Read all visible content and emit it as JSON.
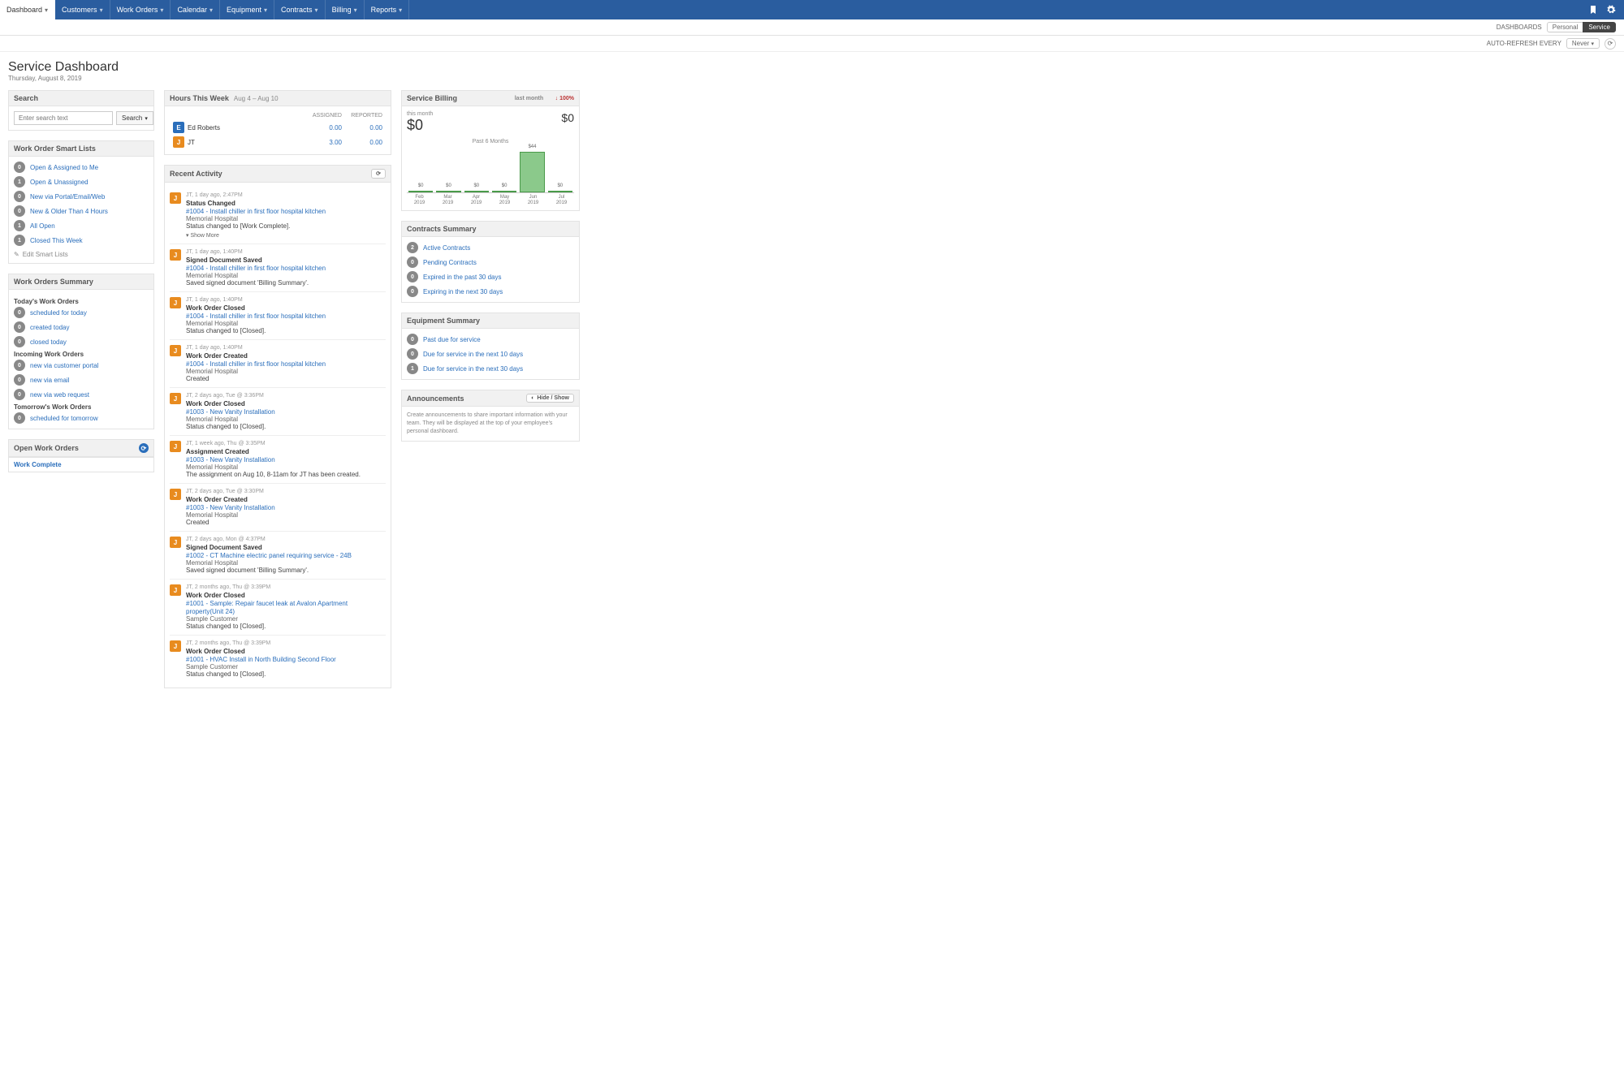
{
  "nav": {
    "tabs": [
      "Dashboard",
      "Customers",
      "Work Orders",
      "Calendar",
      "Equipment",
      "Contracts",
      "Billing",
      "Reports"
    ],
    "active": 0
  },
  "subbar": {
    "dashboards_label": "DASHBOARDS",
    "personal": "Personal",
    "service": "Service",
    "auto_refresh_label": "AUTO-REFRESH EVERY",
    "auto_refresh_value": "Never"
  },
  "header": {
    "title": "Service Dashboard",
    "date": "Thursday, August 8, 2019"
  },
  "search": {
    "title": "Search",
    "placeholder": "Enter search text",
    "button": "Search"
  },
  "smart_lists": {
    "title": "Work Order Smart Lists",
    "items": [
      {
        "count": "0",
        "label": "Open & Assigned to Me"
      },
      {
        "count": "1",
        "label": "Open & Unassigned"
      },
      {
        "count": "0",
        "label": "New via Portal/Email/Web"
      },
      {
        "count": "0",
        "label": "New & Older Than 4 Hours"
      },
      {
        "count": "1",
        "label": "All Open"
      },
      {
        "count": "1",
        "label": "Closed This Week"
      }
    ],
    "edit": "Edit Smart Lists"
  },
  "wo_summary": {
    "title": "Work Orders Summary",
    "groups": [
      {
        "label": "Today's Work Orders",
        "items": [
          {
            "count": "0",
            "label": "scheduled for today"
          },
          {
            "count": "0",
            "label": "created today"
          },
          {
            "count": "0",
            "label": "closed today"
          }
        ]
      },
      {
        "label": "Incoming Work Orders",
        "items": [
          {
            "count": "0",
            "label": "new via customer portal"
          },
          {
            "count": "0",
            "label": "new via email"
          },
          {
            "count": "0",
            "label": "new via web request"
          }
        ]
      },
      {
        "label": "Tomorrow's Work Orders",
        "items": [
          {
            "count": "0",
            "label": "scheduled for tomorrow"
          }
        ]
      }
    ]
  },
  "open_wo": {
    "title": "Open Work Orders",
    "bar": "Work Complete"
  },
  "hours": {
    "title": "Hours This Week",
    "range": "Aug 4 – Aug 10",
    "cols": [
      "ASSIGNED",
      "REPORTED"
    ],
    "rows": [
      {
        "avatar": "E",
        "color": "blue",
        "name": "Ed Roberts",
        "assigned": "0.00",
        "reported": "0.00"
      },
      {
        "avatar": "J",
        "color": "orange",
        "name": "JT",
        "assigned": "3.00",
        "reported": "0.00"
      }
    ]
  },
  "activity": {
    "title": "Recent Activity",
    "reload": "",
    "items": [
      {
        "avatar": "J",
        "meta": "JT, 1 day ago, 2:47PM",
        "title": "Status Changed",
        "link": "#1004 - Install chiller in first floor hospital kitchen",
        "sub": "Memorial Hospital",
        "body": "Status changed to [Work Complete].",
        "more": true
      },
      {
        "avatar": "J",
        "meta": "JT, 1 day ago, 1:40PM",
        "title": "Signed Document Saved",
        "link": "#1004 - Install chiller in first floor hospital kitchen",
        "sub": "Memorial Hospital",
        "body": "Saved signed document 'Billing Summary'."
      },
      {
        "avatar": "J",
        "meta": "JT, 1 day ago, 1:40PM",
        "title": "Work Order Closed",
        "link": "#1004 - Install chiller in first floor hospital kitchen",
        "sub": "Memorial Hospital",
        "body": "Status changed to [Closed]."
      },
      {
        "avatar": "J",
        "meta": "JT, 1 day ago, 1:40PM",
        "title": "Work Order Created",
        "link": "#1004 - Install chiller in first floor hospital kitchen",
        "sub": "Memorial Hospital",
        "body": "Created"
      },
      {
        "avatar": "J",
        "meta": "JT, 2 days ago, Tue @ 3:36PM",
        "title": "Work Order Closed",
        "link": "#1003 - New Vanity Installation",
        "sub": "Memorial Hospital",
        "body": "Status changed to [Closed]."
      },
      {
        "avatar": "J",
        "meta": "JT, 1 week ago, Thu @ 3:35PM",
        "title": "Assignment Created",
        "link": "#1003 - New Vanity Installation",
        "sub": "Memorial Hospital",
        "body": "The assignment on Aug 10, 8-11am for JT has been created."
      },
      {
        "avatar": "J",
        "meta": "JT, 2 days ago, Tue @ 3:30PM",
        "title": "Work Order Created",
        "link": "#1003 - New Vanity Installation",
        "sub": "Memorial Hospital",
        "body": "Created"
      },
      {
        "avatar": "J",
        "meta": "JT, 2 days ago, Mon @ 4:37PM",
        "title": "Signed Document Saved",
        "link": "#1002 - CT Machine electric panel requiring service - 24B",
        "sub": "Memorial Hospital",
        "body": "Saved signed document 'Billing Summary'."
      },
      {
        "avatar": "J",
        "meta": "JT, 2 months ago, Thu @ 3:39PM",
        "title": "Work Order Closed",
        "link": "#1001 - Sample: Repair faucet leak at Avalon Apartment property(Unit 24)",
        "sub": "Sample Customer",
        "body": "Status changed to [Closed]."
      },
      {
        "avatar": "J",
        "meta": "JT, 2 months ago, Thu @ 3:39PM",
        "title": "Work Order Closed",
        "link": "#1001 - HVAC Install in North Building Second Floor",
        "sub": "Sample Customer",
        "body": "Status changed to [Closed]."
      }
    ]
  },
  "billing": {
    "title": "Service Billing",
    "this_month_label": "this month",
    "this_month_value": "$0",
    "last_month_label": "last month",
    "delta": "↓ 100%",
    "last_month_value": "$0",
    "chart_label": "Past 6 Months"
  },
  "chart_data": {
    "type": "bar",
    "categories": [
      "Feb 2019",
      "Mar 2019",
      "Apr 2019",
      "May 2019",
      "Jun 2019",
      "Jul 2019"
    ],
    "values": [
      0,
      0,
      0,
      0,
      44,
      0
    ],
    "value_labels": [
      "$0",
      "$0",
      "$0",
      "$0",
      "$44",
      "$0"
    ],
    "title": "Past 6 Months",
    "xlabel": "",
    "ylabel": "",
    "ylim": [
      0,
      50
    ]
  },
  "contracts": {
    "title": "Contracts Summary",
    "items": [
      {
        "count": "2",
        "label": "Active Contracts"
      },
      {
        "count": "0",
        "label": "Pending Contracts"
      },
      {
        "count": "0",
        "label": "Expired in the past 30 days"
      },
      {
        "count": "0",
        "label": "Expiring in the next 30 days"
      }
    ]
  },
  "equipment": {
    "title": "Equipment Summary",
    "items": [
      {
        "count": "0",
        "label": "Past due for service"
      },
      {
        "count": "0",
        "label": "Due for service in the next 10 days"
      },
      {
        "count": "1",
        "label": "Due for service in the next 30 days"
      }
    ]
  },
  "announcements": {
    "title": "Announcements",
    "hide": "Hide / Show",
    "body": "Create announcements to share important information with your team. They will be displayed at the top of your employee's personal dashboard."
  }
}
